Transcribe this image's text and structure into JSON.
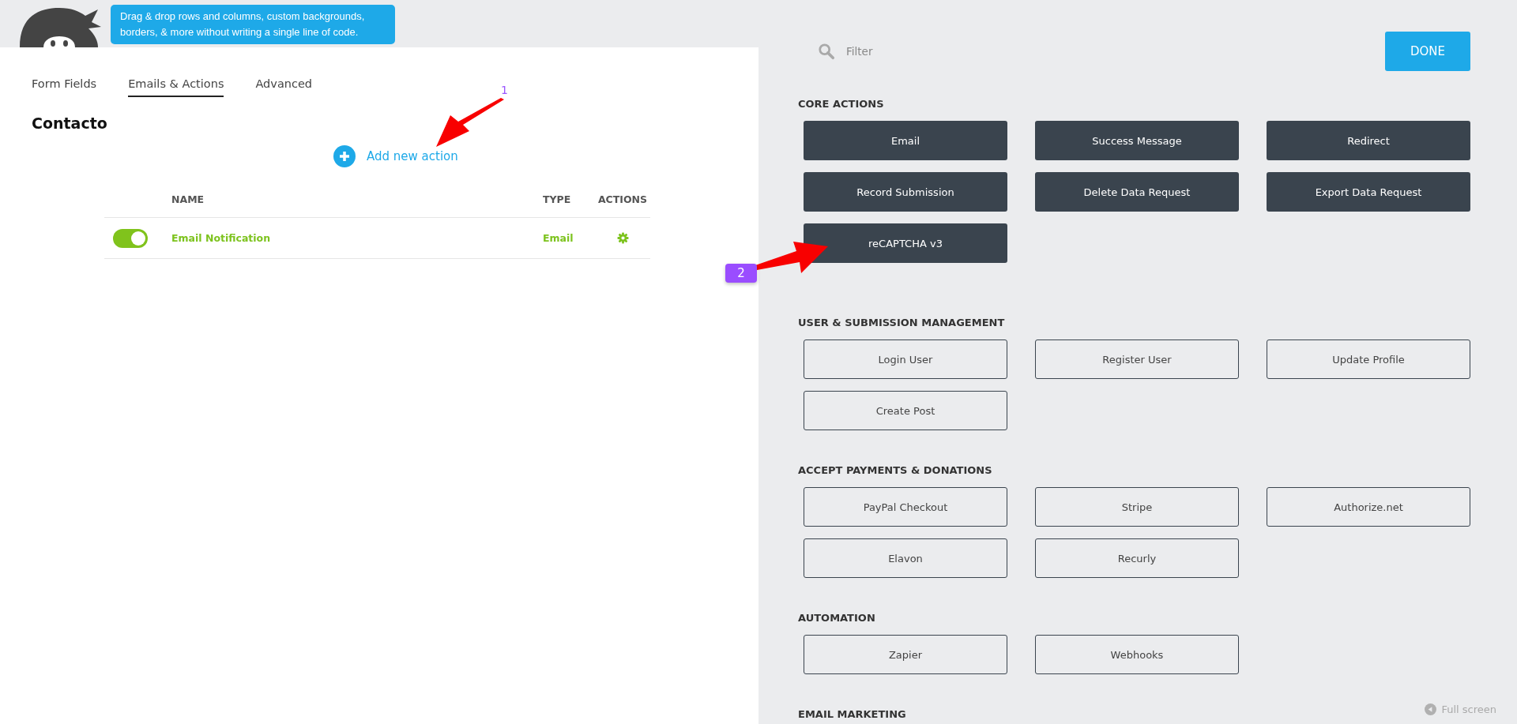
{
  "tooltip": {
    "text": "Drag & drop rows and columns, custom backgrounds, borders, & more without writing a single line of code."
  },
  "tabs": [
    {
      "label": "Form Fields",
      "selected": false
    },
    {
      "label": "Emails & Actions",
      "selected": true
    },
    {
      "label": "Advanced",
      "selected": false
    }
  ],
  "form_title": "Contacto",
  "add_action": {
    "label": "Add new action"
  },
  "table": {
    "columns": [
      "NAME",
      "TYPE",
      "ACTIONS"
    ],
    "rows": [
      {
        "on": true,
        "name": "Email Notification",
        "type": "Email"
      }
    ]
  },
  "filter": {
    "placeholder": "Filter"
  },
  "done_button": "DONE",
  "sections": [
    {
      "title": "CORE ACTIONS",
      "actions": [
        {
          "label": "Email",
          "kind": "dark"
        },
        {
          "label": "Success Message",
          "kind": "dark"
        },
        {
          "label": "Redirect",
          "kind": "dark"
        },
        {
          "label": "Record Submission",
          "kind": "dark"
        },
        {
          "label": "Delete Data Request",
          "kind": "dark"
        },
        {
          "label": "Export Data Request",
          "kind": "dark"
        },
        {
          "label": "reCAPTCHA v3",
          "kind": "dark"
        }
      ]
    },
    {
      "title": "USER & SUBMISSION MANAGEMENT",
      "actions": [
        {
          "label": "Login User",
          "kind": "outline"
        },
        {
          "label": "Register User",
          "kind": "outline"
        },
        {
          "label": "Update Profile",
          "kind": "outline"
        },
        {
          "label": "Create Post",
          "kind": "outline"
        }
      ]
    },
    {
      "title": "ACCEPT PAYMENTS & DONATIONS",
      "actions": [
        {
          "label": "PayPal Checkout",
          "kind": "outline"
        },
        {
          "label": "Stripe",
          "kind": "outline"
        },
        {
          "label": "Authorize.net",
          "kind": "outline"
        },
        {
          "label": "Elavon",
          "kind": "outline"
        },
        {
          "label": "Recurly",
          "kind": "outline"
        }
      ]
    },
    {
      "title": "AUTOMATION",
      "actions": [
        {
          "label": "Zapier",
          "kind": "outline"
        },
        {
          "label": "Webhooks",
          "kind": "outline"
        }
      ]
    },
    {
      "title": "EMAIL MARKETING"
    }
  ],
  "full_screen": "Full screen",
  "annotations": [
    {
      "label": "1"
    },
    {
      "label": "2"
    }
  ]
}
